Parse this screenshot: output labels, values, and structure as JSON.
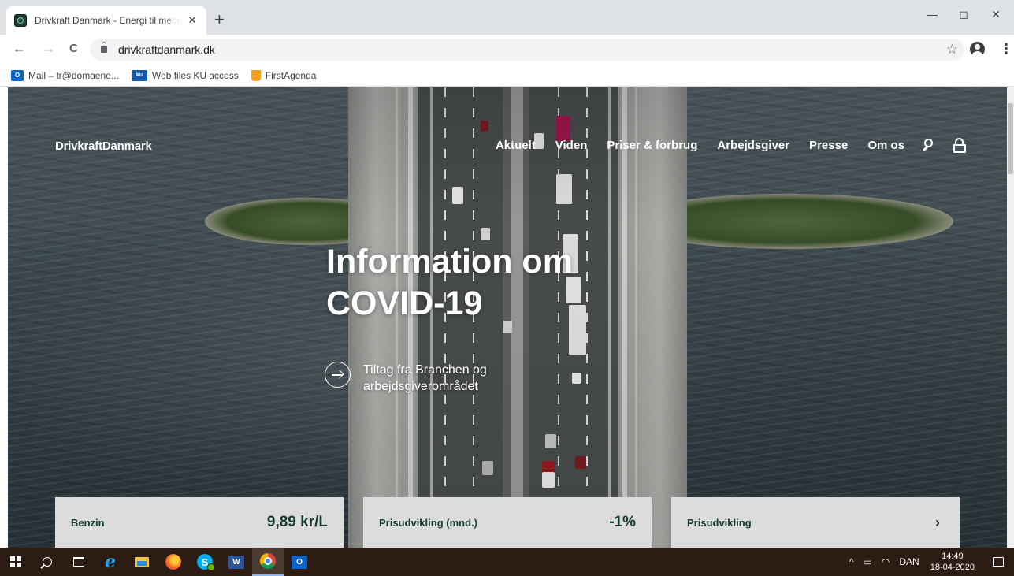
{
  "browser": {
    "tab": {
      "title": "Drivkraft Danmark - Energi til mennesker"
    },
    "new_tab": "+",
    "close_tab": "✕",
    "window": {
      "minimize": "—",
      "maximize": "◻",
      "close": "✕"
    },
    "nav": {
      "back": "←",
      "forward": "→",
      "reload": "C"
    },
    "address": "drivkraftdanmark.dk",
    "star": "☆",
    "menu": "⋮",
    "bookmarks": [
      {
        "icon": "outlook-icon",
        "label": "Mail – tr@domaene..."
      },
      {
        "icon": "ku-icon",
        "label": "Web files KU access"
      },
      {
        "icon": "firstagenda-icon",
        "label": "FirstAgenda"
      }
    ]
  },
  "site": {
    "logo": "DrivkraftDanmark",
    "nav": [
      "Aktuelt",
      "Viden",
      "Priser & forbrug",
      "Arbejdsgiver",
      "Presse",
      "Om os"
    ],
    "hero": {
      "title_line1": "Information om",
      "title_line2": "COVID-19",
      "link": "Tiltag fra Branchen og arbejdsgiverområdet"
    },
    "cards": [
      {
        "label": "Benzin",
        "value": "9,89 kr/L"
      },
      {
        "label": "Prisudvikling (mnd.)",
        "value": "-1%"
      },
      {
        "label": "Prisudvikling",
        "value": ""
      }
    ],
    "cards_next": "›"
  },
  "taskbar": {
    "tray": {
      "chevron": "^",
      "battery": "▭",
      "wifi": "◠",
      "lang": "DAN"
    },
    "time": "14:49",
    "date": "18-04-2020",
    "word_label": "W",
    "outlook_label": "O",
    "skype_label": "S"
  }
}
